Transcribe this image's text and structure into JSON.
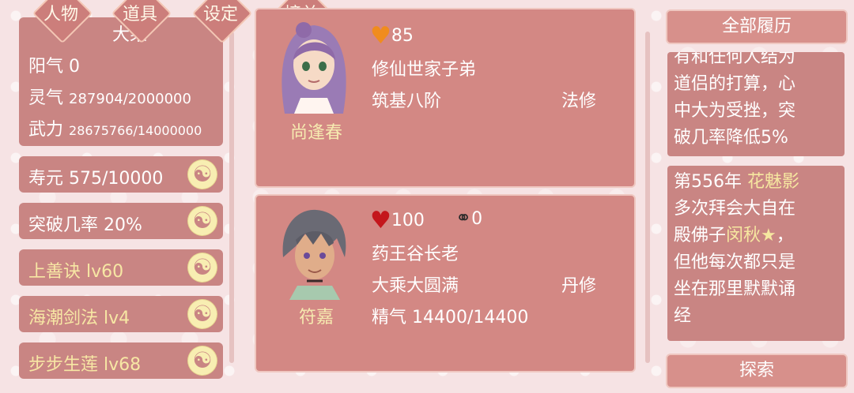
{
  "tabs": [
    {
      "label": "人物"
    },
    {
      "label": "道具"
    },
    {
      "label": "设定"
    },
    {
      "label": "榜单"
    }
  ],
  "stats": {
    "cultivation_partial": "大乘",
    "yangqi_label": "阳气",
    "yangqi_value": "0",
    "lingqi_label": "灵气",
    "lingqi_value": "287904/2000000",
    "wuli_label": "武力",
    "wuli_value": "28675766/14000000"
  },
  "left_buttons": [
    {
      "label": "寿元 575/10000"
    },
    {
      "label": "突破几率 20%"
    },
    {
      "label": "上善诀 lv60"
    },
    {
      "label": "海潮剑法 lv4"
    },
    {
      "label": "步步生莲 lv68"
    }
  ],
  "characters": [
    {
      "name": "尚逢春",
      "heart_value": "85",
      "background": "修仙世家子弟",
      "realm": "筑基八阶",
      "path": "法修"
    },
    {
      "name": "符嘉",
      "heart_value": "100",
      "bond_value": "0",
      "background": "药王谷长老",
      "realm": "大乘大圆满",
      "path": "丹修",
      "essence": "精气 14400/14400"
    }
  ],
  "right_panel": {
    "history_button": "全部履历",
    "explore_button": "探索",
    "log1_lines": [
      "有和任何人结为",
      "道侣的打算，心",
      "中大为受挫，突",
      "破几率降低5%"
    ],
    "log2": {
      "line1_prefix": "第556年 ",
      "line1_name": "花魅影",
      "line2": "多次拜会大自在",
      "line3_prefix": "殿佛子",
      "line3_name": "闵秋★",
      "line3_suffix": "，",
      "line4": "但他每次都只是",
      "line5": "坐在那里默默诵",
      "line6": "经"
    }
  },
  "colors": {
    "panel": "#c98583",
    "gold_text": "#f6e7a0",
    "heart_orange": "#f08c1e",
    "heart_red": "#c4161c"
  }
}
